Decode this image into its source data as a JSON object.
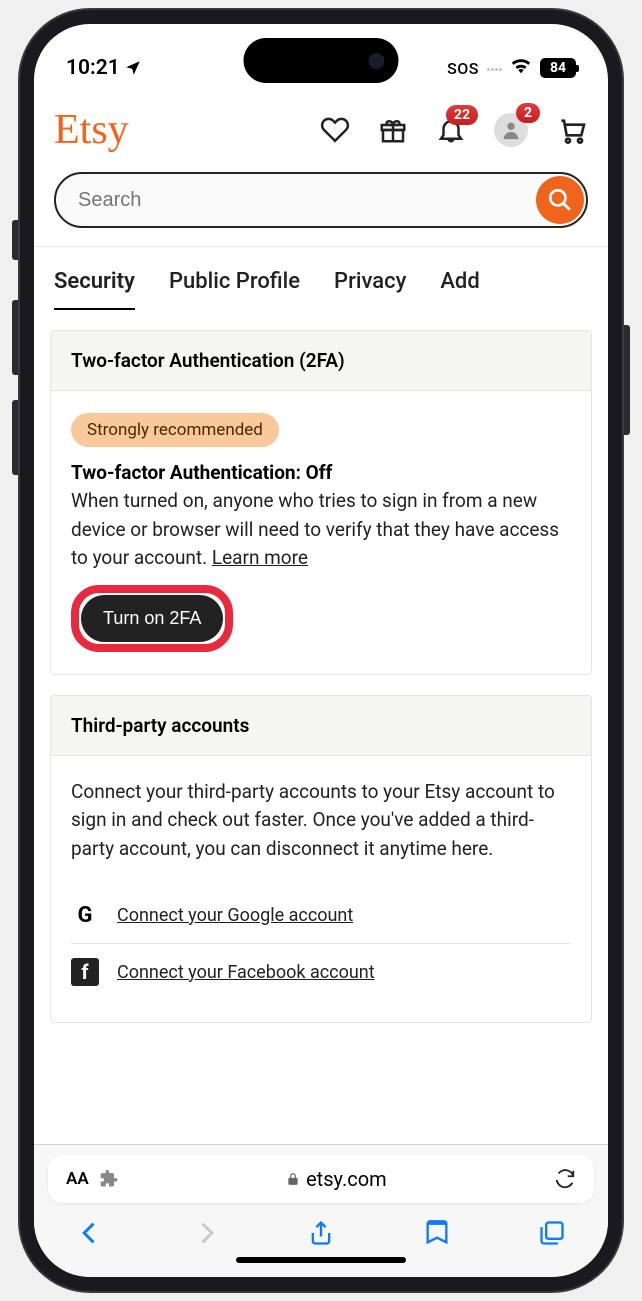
{
  "status": {
    "time": "10:21",
    "sos": "SOS",
    "battery": "84"
  },
  "header": {
    "logo": "Etsy",
    "search_placeholder": "Search",
    "badges": {
      "bell": "22",
      "account": "2"
    }
  },
  "tabs": [
    "Security",
    "Public Profile",
    "Privacy",
    "Add"
  ],
  "tfa": {
    "card_title": "Two-factor Authentication (2FA)",
    "pill": "Strongly recommended",
    "status_title": "Two-factor Authentication: Off",
    "description": "When turned on, anyone who tries to sign in from a new device or browser will need to verify that they have access to your account. ",
    "learn_more": "Learn more",
    "button": "Turn on 2FA"
  },
  "third_party": {
    "card_title": "Third-party accounts",
    "description": "Connect your third-party accounts to your Etsy account to sign in and check out faster. Once you've added a third-party account, you can disconnect it anytime here.",
    "google": "Connect your Google account",
    "facebook": "Connect your Facebook account"
  },
  "browser": {
    "domain": "etsy.com",
    "reader": "AA"
  }
}
